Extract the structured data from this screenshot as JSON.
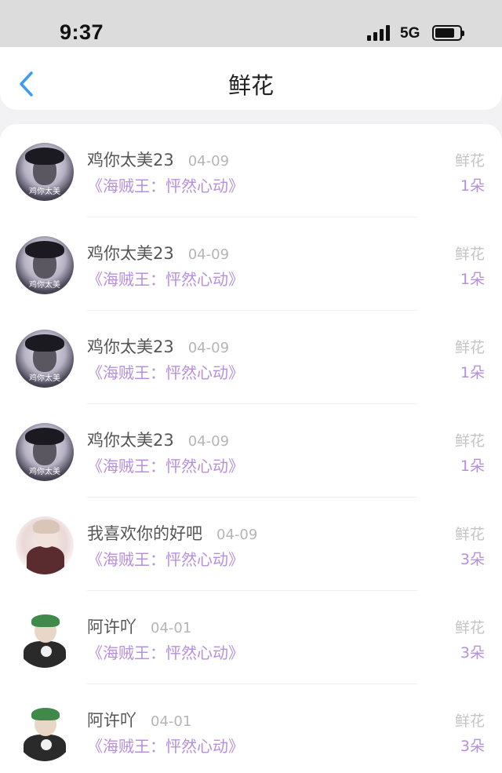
{
  "status": {
    "time": "9:37",
    "network": "5G"
  },
  "nav": {
    "title": "鲜花"
  },
  "rows": [
    {
      "name": "鸡你太美23",
      "date": "04-09",
      "work": "《海贼王：怦然心动》",
      "type": "鲜花",
      "count": "1朵",
      "avatar_caption": "鸡你太美"
    },
    {
      "name": "鸡你太美23",
      "date": "04-09",
      "work": "《海贼王：怦然心动》",
      "type": "鲜花",
      "count": "1朵",
      "avatar_caption": "鸡你太美"
    },
    {
      "name": "鸡你太美23",
      "date": "04-09",
      "work": "《海贼王：怦然心动》",
      "type": "鲜花",
      "count": "1朵",
      "avatar_caption": "鸡你太美"
    },
    {
      "name": "鸡你太美23",
      "date": "04-09",
      "work": "《海贼王：怦然心动》",
      "type": "鲜花",
      "count": "1朵",
      "avatar_caption": "鸡你太美"
    },
    {
      "name": "我喜欢你的好吧",
      "date": "04-09",
      "work": "《海贼王：怦然心动》",
      "type": "鲜花",
      "count": "3朵"
    },
    {
      "name": "阿许吖",
      "date": "04-01",
      "work": "《海贼王：怦然心动》",
      "type": "鲜花",
      "count": "3朵"
    },
    {
      "name": "阿许吖",
      "date": "04-01",
      "work": "《海贼王：怦然心动》",
      "type": "鲜花",
      "count": "3朵"
    }
  ],
  "colors": {
    "accent": "#b78fe0",
    "back_arrow": "#3a9df0"
  }
}
